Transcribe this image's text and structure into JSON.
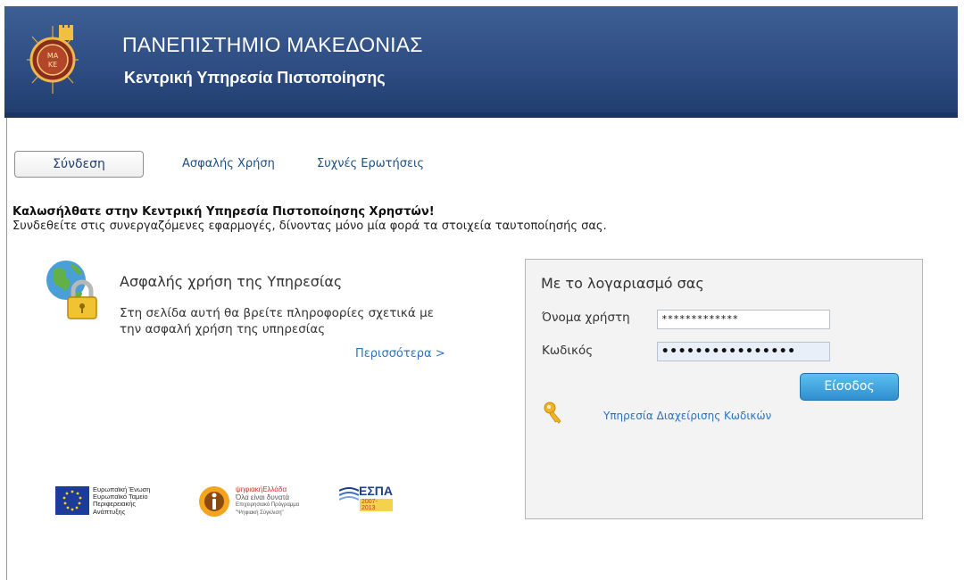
{
  "header": {
    "title": "ΠΑΝΕΠΙΣΤΗΜΙΟ ΜΑΚΕΔΟΝΙΑΣ",
    "subtitle": "Κεντρική Υπηρεσία Πιστοποίησης",
    "logo_icon": "university-seal-icon",
    "colors": {
      "header_bg": "#2e4d82",
      "link": "#2b73c0",
      "button": "#2f8fcf"
    }
  },
  "nav": {
    "tabs": [
      {
        "label": "Σύνδεση",
        "active": true
      },
      {
        "label": "Ασφαλής Χρήση",
        "active": false
      },
      {
        "label": "Συχνές Ερωτήσεις",
        "active": false
      }
    ]
  },
  "welcome": {
    "title": "Καλωσήλθατε στην Κεντρική Υπηρεσία Πιστοποίησης Χρηστών!",
    "text": "Συνδεθείτε στις συνεργαζόμενες εφαρμογές, δίνοντας μόνο μία φορά τα στοιχεία ταυτοποίησής σας."
  },
  "info": {
    "icon": "globe-lock-icon",
    "title": "Ασφαλής χρήση της Υπηρεσίας",
    "text": "Στη σελίδα αυτή θα βρείτε πληροφορίες σχετικά με την ασφαλή χρήση της υπηρεσίας",
    "more_link": "Περισσότερα >"
  },
  "login": {
    "title": "Με το λογαριασμό σας",
    "username_label": "Όνομα χρήστη",
    "username_value": "*************",
    "password_label": "Κωδικός",
    "password_value": "••••••••••••••••",
    "submit_label": "Είσοδος",
    "key_icon": "key-icon",
    "password_service_link": "Υπηρεσία Διαχείρισης Κωδικών"
  },
  "footer_logos": {
    "eu": {
      "lines": [
        "Ευρωπαϊκή Ένωση",
        "Ευρωπαϊκό Ταμείο",
        "Περιφερειακής",
        "Ανάπτυξης"
      ]
    },
    "digital_greece": {
      "lines": [
        "ψηφιακήΕλλάδα",
        "Όλα είναι δυνατά",
        "Επιχειρησιακό Πρόγραμμα",
        "\"Ψηφιακή Σύγκλιση\""
      ]
    },
    "espa": {
      "name": "ΕΣΠΑ",
      "years": "2007-2013"
    }
  }
}
